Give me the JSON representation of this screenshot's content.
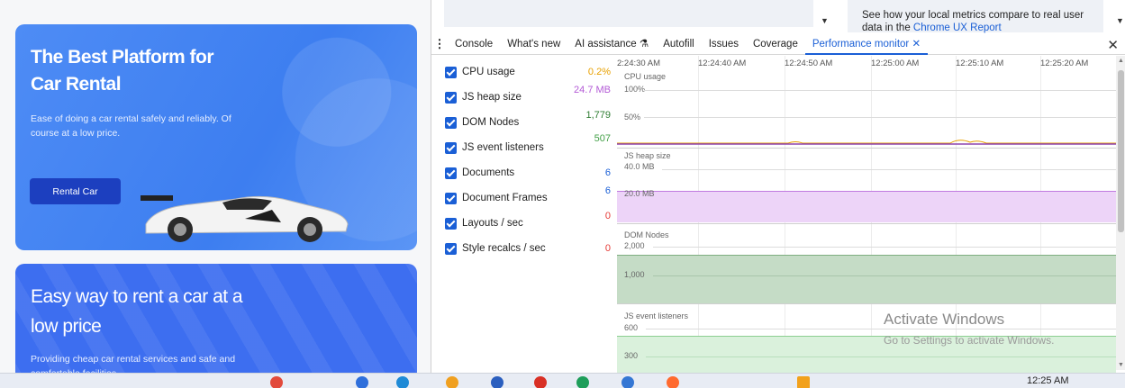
{
  "site": {
    "card1": {
      "title": "The Best Platform for Car Rental",
      "description": "Ease of doing a car rental safely and reliably. Of course at a low price.",
      "button": "Rental Car"
    },
    "card2": {
      "title": "Easy way to rent a car at a low price",
      "description": "Providing cheap car rental services and safe and comfortable facilities."
    }
  },
  "devtools": {
    "top_info": {
      "text": "See how your local metrics compare to real user data in the ",
      "link": "Chrome UX Report"
    },
    "tabs": [
      "Console",
      "What's new",
      "AI assistance",
      "Autofill",
      "Issues",
      "Coverage",
      "Performance monitor"
    ],
    "active_tab": "Performance monitor",
    "metrics": [
      {
        "label": "CPU usage",
        "value": "0.2%",
        "color": "#e8a000"
      },
      {
        "label": "JS heap size",
        "value": "24.7 MB",
        "color": "#b35ad6"
      },
      {
        "label": "DOM Nodes",
        "value": "1,779",
        "color": "#2e7d32"
      },
      {
        "label": "JS event listeners",
        "value": "507",
        "color": "#43a047"
      },
      {
        "label": "Documents",
        "value": "6",
        "color": "#1a5fd6"
      },
      {
        "label": "Document Frames",
        "value": "6",
        "color": "#1a5fd6"
      },
      {
        "label": "Layouts / sec",
        "value": "0",
        "color": "#e53935"
      },
      {
        "label": "Style recalcs / sec",
        "value": "0",
        "color": "#e53935"
      }
    ],
    "times": [
      "2:24:30 AM",
      "12:24:40 AM",
      "12:24:50 AM",
      "12:25:00 AM",
      "12:25:10 AM",
      "12:25:20 AM"
    ],
    "panes": {
      "cpu": {
        "label": "CPU usage",
        "ticks": [
          "100%",
          "50%"
        ]
      },
      "heap": {
        "label": "JS heap size",
        "ticks": [
          "40.0 MB",
          "20.0 MB"
        ]
      },
      "dom": {
        "label": "DOM Nodes",
        "ticks": [
          "2,000",
          "1,000"
        ]
      },
      "listeners": {
        "label": "JS event listeners",
        "ticks": [
          "600",
          "300"
        ]
      }
    }
  },
  "watermark": {
    "title": "Activate Windows",
    "subtitle": "Go to Settings to activate Windows."
  },
  "clock": "12:25 AM"
}
